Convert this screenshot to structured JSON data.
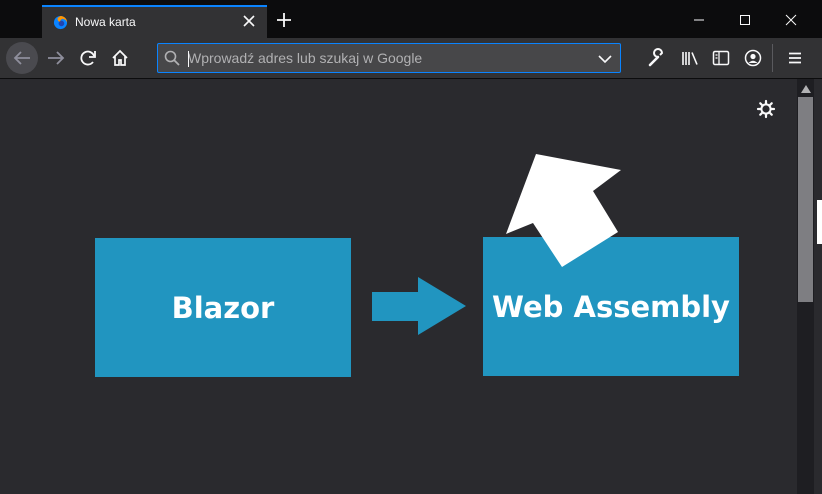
{
  "tab": {
    "title": "Nowa karta",
    "favicon": "firefox-logo-icon",
    "close_icon": "close-icon"
  },
  "window_controls": [
    "minimize-icon",
    "maximize-icon",
    "close-icon"
  ],
  "navigation": {
    "back": "back-arrow-icon",
    "forward": "forward-arrow-icon",
    "reload": "reload-icon",
    "home": "home-icon"
  },
  "urlbar": {
    "value": "",
    "placeholder": "Wprowadź adres lub szukaj w Google",
    "search_icon": "search-icon",
    "dropdown_icon": "chevron-down-icon"
  },
  "toolbar_icons": [
    "wrench-icon",
    "library-icon",
    "sidebar-icon",
    "account-icon",
    "hamburger-menu-icon"
  ],
  "content": {
    "settings_icon": "gear-icon",
    "box_left_label": "Blazor",
    "box_right_label": "Web Assembly"
  },
  "colors": {
    "accent": "#0a84ff",
    "background": "#2a2a2e",
    "box": "#2195c0",
    "arrow_white": "#ffffff"
  }
}
